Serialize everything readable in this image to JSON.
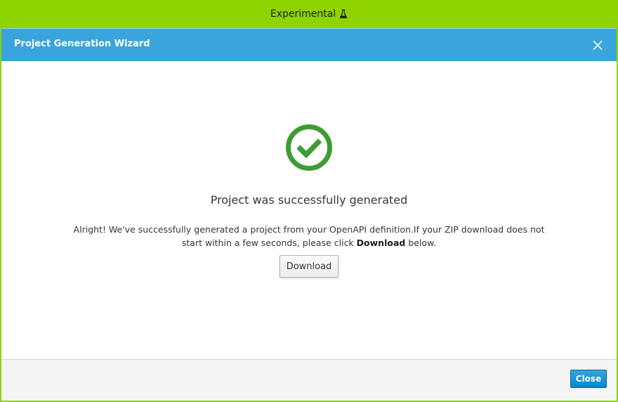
{
  "banner": {
    "label": "Experimental",
    "icon": "flask-icon"
  },
  "modal": {
    "title": "Project Generation Wizard",
    "close_icon": "close-icon",
    "success_icon": "check-circle-icon",
    "heading": "Project was successfully generated",
    "message_part1": "Alright! We've successfully generated a project from your OpenAPI definition.If your ZIP download does not start within a few seconds, please click",
    "message_bold": "Download",
    "message_part2": "below.",
    "download_label": "Download",
    "close_label": "Close"
  },
  "colors": {
    "banner_background": "#8fd400",
    "header_background": "#39a5dc",
    "success_green": "#3f9c35",
    "primary_button": "#0088ce"
  }
}
